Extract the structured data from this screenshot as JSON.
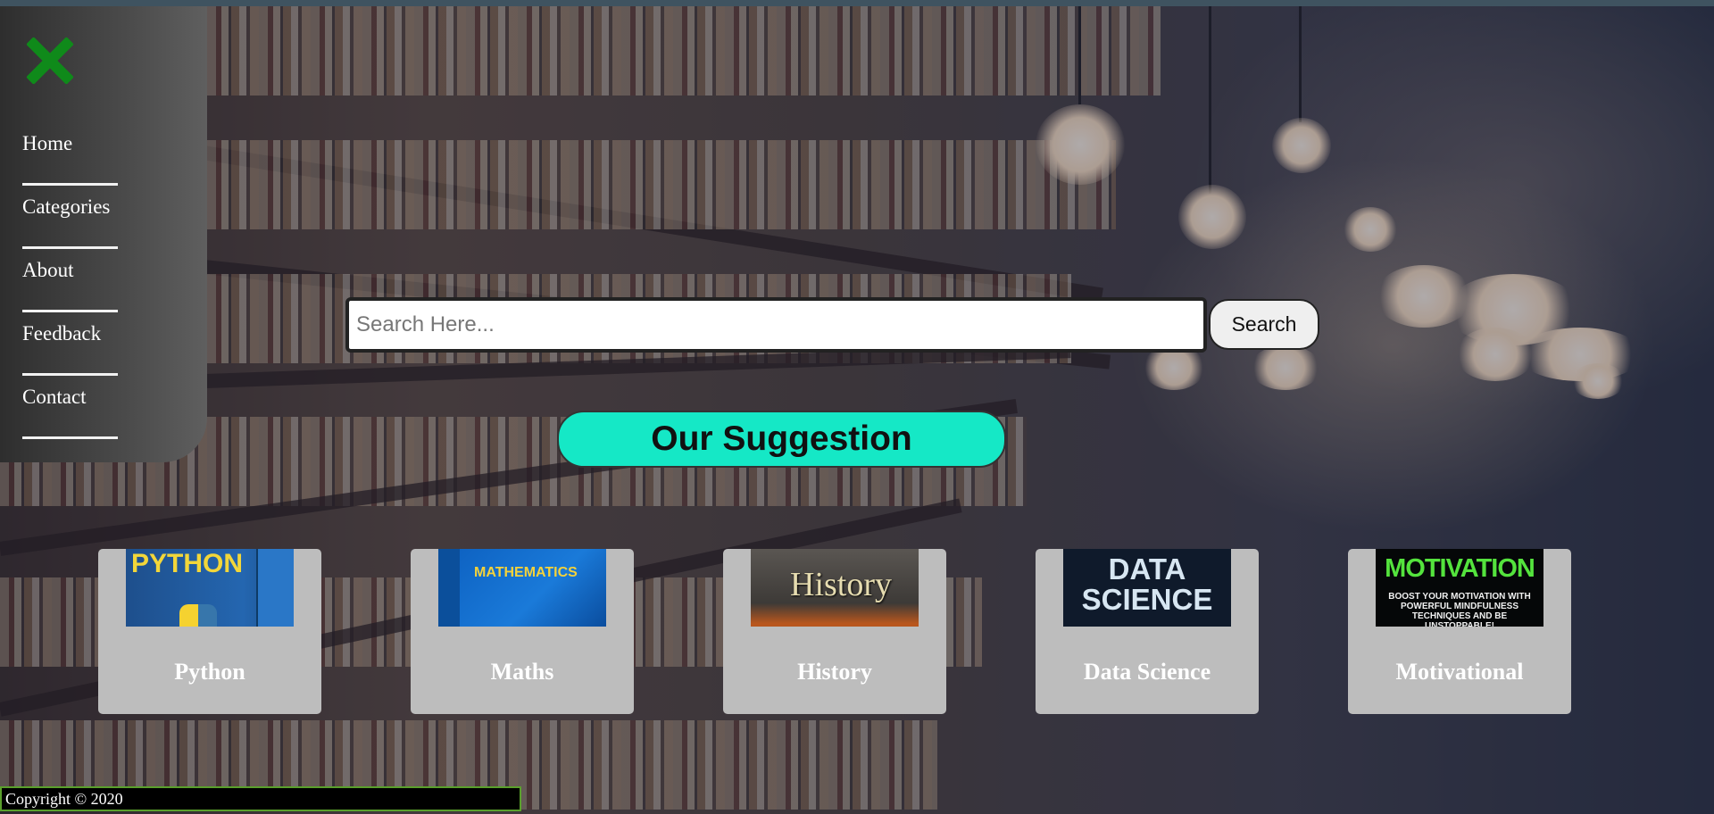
{
  "nav": {
    "close_icon": "close-x-icon",
    "close_color": "#0f8a1a",
    "items": [
      {
        "label": "Home"
      },
      {
        "label": "Categories"
      },
      {
        "label": "About"
      },
      {
        "label": "Feedback"
      },
      {
        "label": "Contact"
      }
    ]
  },
  "search": {
    "placeholder": "Search Here...",
    "value": "",
    "button_label": "Search"
  },
  "suggestion": {
    "heading": "Our Suggestion",
    "accent": "#15e8c6"
  },
  "cards": [
    {
      "label": "Python",
      "cover_text": "PYTHON"
    },
    {
      "label": "Maths",
      "cover_text": "MATHEMATICS"
    },
    {
      "label": "History",
      "cover_text": "History"
    },
    {
      "label": "Data Science",
      "cover_text": "DATA SCIENCE"
    },
    {
      "label": "Motivational",
      "cover_text": "MOTIVATION",
      "cover_subtext": "BOOST YOUR MOTIVATION WITH POWERFUL MINDFULNESS TECHNIQUES AND BE UNSTOPPABLE!"
    }
  ],
  "footer": {
    "text": "Copyright © 2020"
  }
}
